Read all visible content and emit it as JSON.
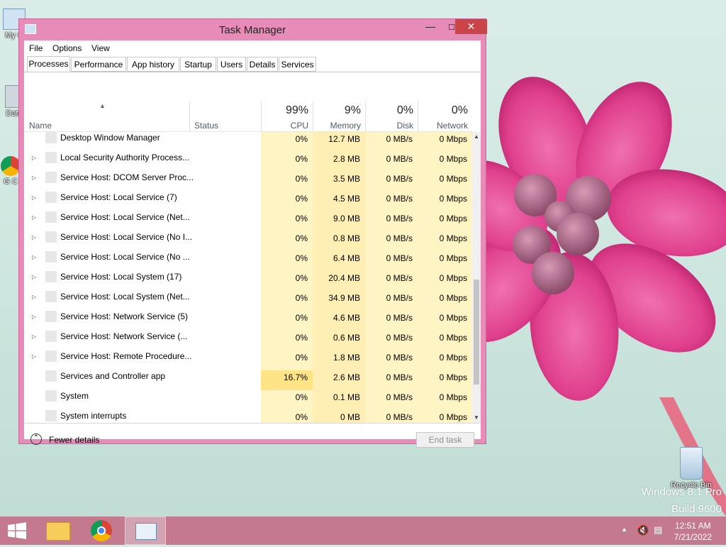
{
  "desktop": {
    "icons": [
      {
        "label": "My C"
      },
      {
        "label": "Data"
      },
      {
        "label": "G C"
      },
      {
        "label": "Recycle Bin"
      }
    ],
    "watermark_line1": "Windows 8.1 Pro",
    "watermark_line2": "Build 9600"
  },
  "window": {
    "title": "Task Manager",
    "min_label": "▭",
    "max_label": "☐",
    "close_label": "✕"
  },
  "menu": [
    "File",
    "Options",
    "View"
  ],
  "tabs": [
    "Processes",
    "Performance",
    "App history",
    "Startup",
    "Users",
    "Details",
    "Services"
  ],
  "active_tab": "Processes",
  "columns": {
    "name": "Name",
    "status": "Status",
    "cpu": {
      "pct": "99%",
      "label": "CPU"
    },
    "memory": {
      "pct": "9%",
      "label": "Memory"
    },
    "disk": {
      "pct": "0%",
      "label": "Disk"
    },
    "network": {
      "pct": "0%",
      "label": "Network"
    }
  },
  "rows": [
    {
      "name": "Desktop Window Manager",
      "expandable": false,
      "cpu": "0%",
      "memory": "12.7 MB",
      "disk": "0 MB/s",
      "network": "0 Mbps"
    },
    {
      "name": "Local Security Authority Process...",
      "expandable": true,
      "cpu": "0%",
      "memory": "2.8 MB",
      "disk": "0 MB/s",
      "network": "0 Mbps"
    },
    {
      "name": "Service Host: DCOM Server Proc...",
      "expandable": true,
      "cpu": "0%",
      "memory": "3.5 MB",
      "disk": "0 MB/s",
      "network": "0 Mbps"
    },
    {
      "name": "Service Host: Local Service (7)",
      "expandable": true,
      "cpu": "0%",
      "memory": "4.5 MB",
      "disk": "0 MB/s",
      "network": "0 Mbps"
    },
    {
      "name": "Service Host: Local Service (Net...",
      "expandable": true,
      "cpu": "0%",
      "memory": "9.0 MB",
      "disk": "0 MB/s",
      "network": "0 Mbps"
    },
    {
      "name": "Service Host: Local Service (No I...",
      "expandable": true,
      "cpu": "0%",
      "memory": "0.8 MB",
      "disk": "0 MB/s",
      "network": "0 Mbps"
    },
    {
      "name": "Service Host: Local Service (No ...",
      "expandable": true,
      "cpu": "0%",
      "memory": "6.4 MB",
      "disk": "0 MB/s",
      "network": "0 Mbps"
    },
    {
      "name": "Service Host: Local System (17)",
      "expandable": true,
      "cpu": "0%",
      "memory": "20.4 MB",
      "disk": "0 MB/s",
      "network": "0 Mbps"
    },
    {
      "name": "Service Host: Local System (Net...",
      "expandable": true,
      "cpu": "0%",
      "memory": "34.9 MB",
      "disk": "0 MB/s",
      "network": "0 Mbps"
    },
    {
      "name": "Service Host: Network Service (5)",
      "expandable": true,
      "cpu": "0%",
      "memory": "4.6 MB",
      "disk": "0 MB/s",
      "network": "0 Mbps"
    },
    {
      "name": "Service Host: Network Service (...",
      "expandable": true,
      "cpu": "0%",
      "memory": "0.6 MB",
      "disk": "0 MB/s",
      "network": "0 Mbps"
    },
    {
      "name": "Service Host: Remote Procedure...",
      "expandable": true,
      "cpu": "0%",
      "memory": "1.8 MB",
      "disk": "0 MB/s",
      "network": "0 Mbps"
    },
    {
      "name": "Services and Controller app",
      "expandable": false,
      "cpu": "16.7%",
      "memory": "2.6 MB",
      "disk": "0 MB/s",
      "network": "0 Mbps",
      "highlight": true
    },
    {
      "name": "System",
      "expandable": false,
      "cpu": "0%",
      "memory": "0.1 MB",
      "disk": "0 MB/s",
      "network": "0 Mbps"
    },
    {
      "name": "System interrupts",
      "expandable": false,
      "cpu": "0%",
      "memory": "0 MB",
      "disk": "0 MB/s",
      "network": "0 Mbps"
    }
  ],
  "footer": {
    "fewer_details": "Fewer details",
    "end_task": "End task"
  },
  "taskbar": {
    "time": "12:51 AM",
    "date": "7/21/2022"
  },
  "colors": {
    "window_frame": "#e78cb8",
    "close_button": "#c9454a",
    "taskbar": "#c5798f",
    "heat_light": "#fff4c4",
    "heat_high": "#ffe487"
  }
}
